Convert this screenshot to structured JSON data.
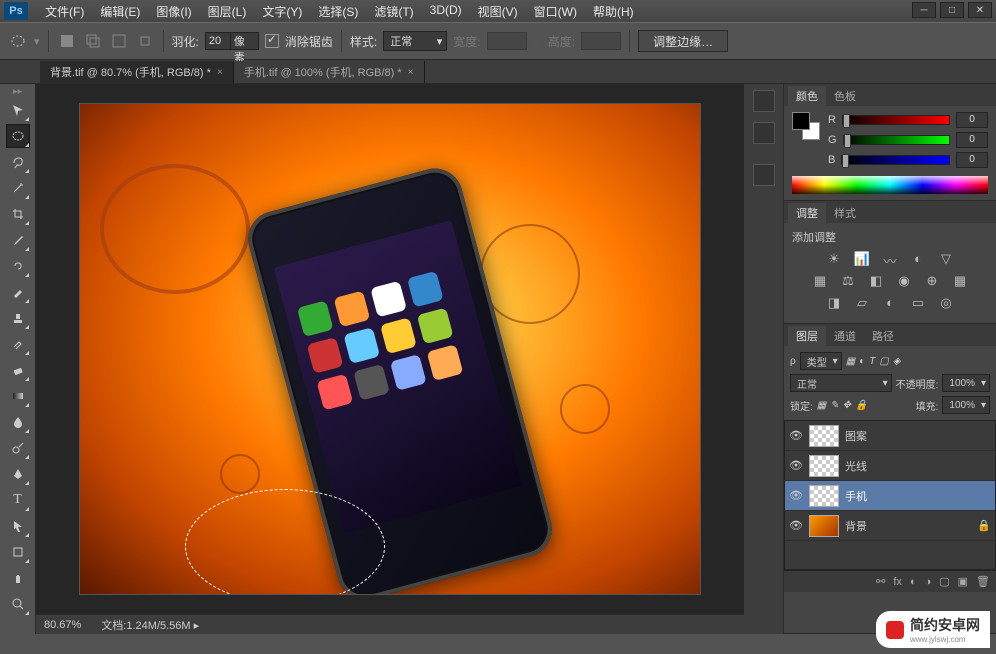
{
  "app_logo": "Ps",
  "menu": [
    "文件(F)",
    "编辑(E)",
    "图像(I)",
    "图层(L)",
    "文字(Y)",
    "选择(S)",
    "滤镜(T)",
    "3D(D)",
    "视图(V)",
    "窗口(W)",
    "帮助(H)"
  ],
  "options": {
    "feather_label": "羽化:",
    "feather_value": "20",
    "feather_unit": "像素",
    "antialias_label": "消除锯齿",
    "style_label": "样式:",
    "style_value": "正常",
    "width_label": "宽度:",
    "height_label": "高度:",
    "refine_btn": "调整边缘…"
  },
  "tabs": [
    {
      "label": "背景.tif @ 80.7% (手机, RGB/8) *",
      "active": true
    },
    {
      "label": "手机.tif @ 100% (手机, RGB/8) *",
      "active": false
    }
  ],
  "status": {
    "zoom": "80.67%",
    "doc_label": "文档:",
    "doc_size": "1.24M/5.56M"
  },
  "panel_color": {
    "tabs": [
      "颜色",
      "色板"
    ],
    "channels": [
      {
        "name": "R",
        "value": "0"
      },
      {
        "name": "G",
        "value": "0"
      },
      {
        "name": "B",
        "value": "0"
      }
    ]
  },
  "panel_adjust": {
    "tabs": [
      "调整",
      "样式"
    ],
    "title": "添加调整"
  },
  "panel_layers": {
    "tabs": [
      "图层",
      "通道",
      "路径"
    ],
    "filter_label": "类型",
    "blend_value": "正常",
    "opacity_label": "不透明度:",
    "opacity_value": "100%",
    "lock_label": "锁定:",
    "fill_label": "填充:",
    "fill_value": "100%",
    "layers": [
      {
        "name": "图案",
        "selected": false,
        "thumb": "pattern"
      },
      {
        "name": "光线",
        "selected": false,
        "thumb": "pattern"
      },
      {
        "name": "手机",
        "selected": true,
        "thumb": "pattern"
      },
      {
        "name": "背景",
        "selected": false,
        "thumb": "img",
        "locked": true
      }
    ]
  },
  "watermark": {
    "brand": "简约安卓网",
    "url": "www.jylswj.com"
  }
}
